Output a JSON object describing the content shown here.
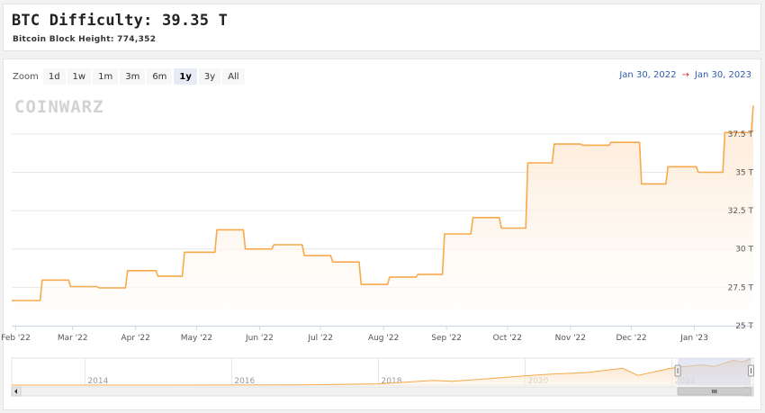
{
  "header": {
    "title": "BTC Difficulty: 39.35 T",
    "subtitle": "Bitcoin Block Height: 774,352"
  },
  "range_selector": {
    "zoom_label": "Zoom",
    "buttons": [
      "1d",
      "1w",
      "1m",
      "3m",
      "6m",
      "1y",
      "3y",
      "All"
    ],
    "active": "1y",
    "from_date": "Jan 30, 2022",
    "separator": "→",
    "to_date": "Jan 30, 2023"
  },
  "watermark": "COINWARZ",
  "colors": {
    "line": "#f7a94b",
    "area_top": "#fde7d0",
    "grid": "#e6e6e6",
    "navigator_mask": "#ccd6eb"
  },
  "chart_data": {
    "type": "area",
    "title": "",
    "xlabel": "",
    "ylabel": "",
    "ylim": [
      25,
      39.6
    ],
    "yticks": [
      25,
      27.5,
      30,
      32.5,
      35,
      37.5
    ],
    "ytick_labels": [
      "25 T",
      "27.5 T",
      "30 T",
      "32.5 T",
      "35 T",
      "37.5 T"
    ],
    "xticks": [
      {
        "x": "2022-02-01",
        "label": "Feb '22"
      },
      {
        "x": "2022-03-01",
        "label": "Mar '22"
      },
      {
        "x": "2022-04-01",
        "label": "Apr '22"
      },
      {
        "x": "2022-05-01",
        "label": "May '22"
      },
      {
        "x": "2022-06-01",
        "label": "Jun '22"
      },
      {
        "x": "2022-07-01",
        "label": "Jul '22"
      },
      {
        "x": "2022-08-01",
        "label": "Aug '22"
      },
      {
        "x": "2022-09-01",
        "label": "Sep '22"
      },
      {
        "x": "2022-10-01",
        "label": "Oct '22"
      },
      {
        "x": "2022-11-01",
        "label": "Nov '22"
      },
      {
        "x": "2022-12-01",
        "label": "Dec '22"
      },
      {
        "x": "2023-01-01",
        "label": "Jan '23"
      }
    ],
    "grid": true,
    "legend": "none",
    "series": [
      {
        "points": [
          [
            "2022-01-30",
            26.64
          ],
          [
            "2022-02-13",
            26.64
          ],
          [
            "2022-02-14",
            27.97
          ],
          [
            "2022-02-27",
            27.97
          ],
          [
            "2022-02-28",
            27.55
          ],
          [
            "2022-03-13",
            27.55
          ],
          [
            "2022-03-14",
            27.46
          ],
          [
            "2022-03-27",
            27.46
          ],
          [
            "2022-03-28",
            28.59
          ],
          [
            "2022-04-11",
            28.59
          ],
          [
            "2022-04-12",
            28.23
          ],
          [
            "2022-04-24",
            28.23
          ],
          [
            "2022-04-25",
            29.79
          ],
          [
            "2022-05-10",
            29.79
          ],
          [
            "2022-05-11",
            31.25
          ],
          [
            "2022-05-24",
            31.25
          ],
          [
            "2022-05-25",
            30.0
          ],
          [
            "2022-06-07",
            30.0
          ],
          [
            "2022-06-08",
            30.28
          ],
          [
            "2022-06-22",
            30.28
          ],
          [
            "2022-06-23",
            29.57
          ],
          [
            "2022-07-06",
            29.57
          ],
          [
            "2022-07-07",
            29.15
          ],
          [
            "2022-07-20",
            29.15
          ],
          [
            "2022-07-21",
            27.69
          ],
          [
            "2022-08-03",
            27.69
          ],
          [
            "2022-08-04",
            28.17
          ],
          [
            "2022-08-17",
            28.17
          ],
          [
            "2022-08-18",
            28.35
          ],
          [
            "2022-08-30",
            28.35
          ],
          [
            "2022-08-31",
            30.98
          ],
          [
            "2022-09-13",
            30.98
          ],
          [
            "2022-09-14",
            32.05
          ],
          [
            "2022-09-27",
            32.05
          ],
          [
            "2022-09-28",
            31.36
          ],
          [
            "2022-10-10",
            31.36
          ],
          [
            "2022-10-11",
            35.61
          ],
          [
            "2022-10-23",
            35.61
          ],
          [
            "2022-10-24",
            36.84
          ],
          [
            "2022-11-06",
            36.84
          ],
          [
            "2022-11-07",
            36.76
          ],
          [
            "2022-11-20",
            36.76
          ],
          [
            "2022-11-21",
            36.95
          ],
          [
            "2022-12-05",
            36.95
          ],
          [
            "2022-12-06",
            34.24
          ],
          [
            "2022-12-18",
            34.24
          ],
          [
            "2022-12-19",
            35.36
          ],
          [
            "2023-01-02",
            35.36
          ],
          [
            "2023-01-03",
            35.0
          ],
          [
            "2023-01-15",
            35.0
          ],
          [
            "2023-01-16",
            37.59
          ],
          [
            "2023-01-29",
            37.59
          ],
          [
            "2023-01-30",
            39.35
          ]
        ]
      }
    ],
    "navigator": {
      "xlabels": [
        "2014",
        "2016",
        "2018",
        "2020",
        "2022"
      ],
      "xlim": [
        "2013-01-01",
        "2023-02-10"
      ],
      "ylim": [
        0,
        40
      ],
      "selection": [
        "2022-01-30",
        "2023-01-30"
      ],
      "points": [
        [
          "2013-01-01",
          0.0
        ],
        [
          "2014-01-01",
          0.0015
        ],
        [
          "2015-01-01",
          0.04
        ],
        [
          "2016-01-01",
          0.1
        ],
        [
          "2017-01-01",
          0.3
        ],
        [
          "2018-01-01",
          1.9
        ],
        [
          "2018-10-01",
          7.1
        ],
        [
          "2019-01-01",
          5.6
        ],
        [
          "2019-08-01",
          10.2
        ],
        [
          "2020-01-01",
          13.8
        ],
        [
          "2020-05-01",
          16.1
        ],
        [
          "2020-11-01",
          18.7
        ],
        [
          "2021-05-01",
          25.0
        ],
        [
          "2021-07-15",
          14.4
        ],
        [
          "2021-12-15",
          24.3
        ],
        [
          "2022-01-30",
          26.6
        ],
        [
          "2022-06-01",
          30.0
        ],
        [
          "2022-08-01",
          27.7
        ],
        [
          "2022-11-01",
          36.8
        ],
        [
          "2022-12-15",
          34.2
        ],
        [
          "2023-01-30",
          39.35
        ]
      ]
    }
  }
}
